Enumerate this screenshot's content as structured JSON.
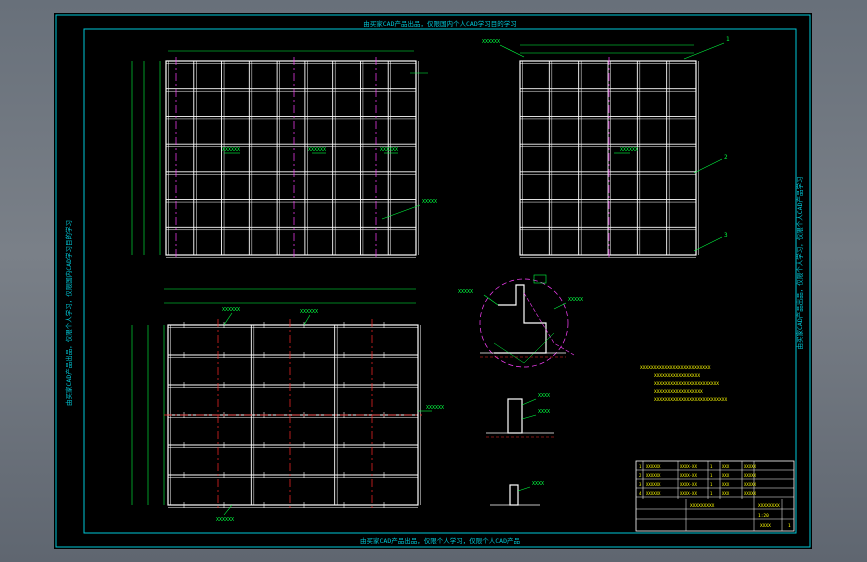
{
  "canvas": {
    "background": "#000000",
    "frame_color": "#00c8d8",
    "colors": {
      "steel": "#ffffff",
      "centerline_magenta": "#ff40ff",
      "centerline_red": "#ff2a2a",
      "dimension": "#00ff40",
      "note": "#ffff00",
      "frame": "#00c8d8"
    }
  },
  "border_texts": {
    "top": "由买家CAD产品出品，仅限国内个人CAD学习目的学习",
    "bottom": "由买家CAD产品出品，仅限个人学习，仅限个人CAD产品",
    "left": "由买家CAD产品出品，仅限个人学习，仅限国内CAD学习目的学习",
    "right": "由买家CAD产品出品，仅限个人学习，仅限个人CAD产品学习"
  },
  "views": {
    "front_elevation": {
      "callouts": [
        "XXXXXX",
        "XXXXXX",
        "XXXXXX",
        "XXXXX"
      ]
    },
    "side_elevation": {
      "callouts": [
        "XXXXXX",
        "XXXXXX"
      ],
      "balloons": [
        "1",
        "2",
        "3"
      ]
    },
    "plan_view": {
      "callouts": [
        "XXXXXX",
        "XXXXXX",
        "XXXXXX",
        "XXXXXX"
      ]
    },
    "section_details": {
      "callouts": [
        "XXXXX",
        "XXXXX",
        "XXXX",
        "XXXX",
        "XXXX"
      ]
    }
  },
  "notes": [
    "XXXXXXXXXXXXXXXXXXXXXXXXXX",
    "XXXXXXXXXXXXXXXXX",
    "XXXXXXXXXXXXXXXXXXXXXXXX",
    "XXXXXXXXXXXXXXXXXX",
    "XXXXXXXXXXXXXXXXXXXXXXXXXXX"
  ],
  "title_block": {
    "rows": [
      [
        "1",
        "XXXXXX",
        "XXXX-XX",
        "1",
        "XXX",
        "XXXXX"
      ],
      [
        "2",
        "XXXXXX",
        "XXXX-XX",
        "1",
        "XXX",
        "XXXXX"
      ],
      [
        "3",
        "XXXXXX",
        "XXXX-XX",
        "1",
        "XXX",
        "XXXXX"
      ],
      [
        "4",
        "XXXXXX",
        "XXXX-XX",
        "1",
        "XXX",
        "XXXXX"
      ]
    ],
    "project": "XXXXXXXXX",
    "drawing_name": "XXXXXXXX",
    "scale": "1:20",
    "sheet": "1",
    "code": "XXXX"
  }
}
